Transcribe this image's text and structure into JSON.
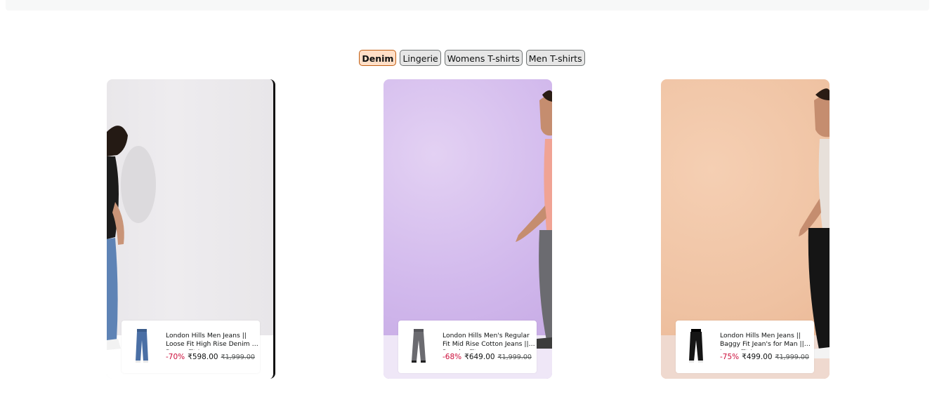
{
  "tabs": [
    {
      "label": "Denim",
      "active": true
    },
    {
      "label": "Lingerie",
      "active": false
    },
    {
      "label": "Womens T-shirts",
      "active": false
    },
    {
      "label": "Men T-shirts",
      "active": false
    }
  ],
  "cards": [
    {
      "product_title": "London Hills Men Jeans || Loose Fit High Rise Denim || Baggy Fit Jeans",
      "discount": "-70%",
      "price": "₹598.00",
      "mrp": "₹1,999.00",
      "jeans_color": "#4a6fa5"
    },
    {
      "product_title": "London Hills Men's Regular Fit Mid Rise Cotton Jeans || Regular Fit",
      "discount": "-68%",
      "price": "₹649.00",
      "mrp": "₹1,999.00",
      "jeans_color": "#6b6b70"
    },
    {
      "product_title": "London Hills Men Jeans || Baggy Fit Jean's for Man || Loose Fit Jeans",
      "discount": "-75%",
      "price": "₹499.00",
      "mrp": "₹1,999.00",
      "jeans_color": "#151515"
    }
  ]
}
